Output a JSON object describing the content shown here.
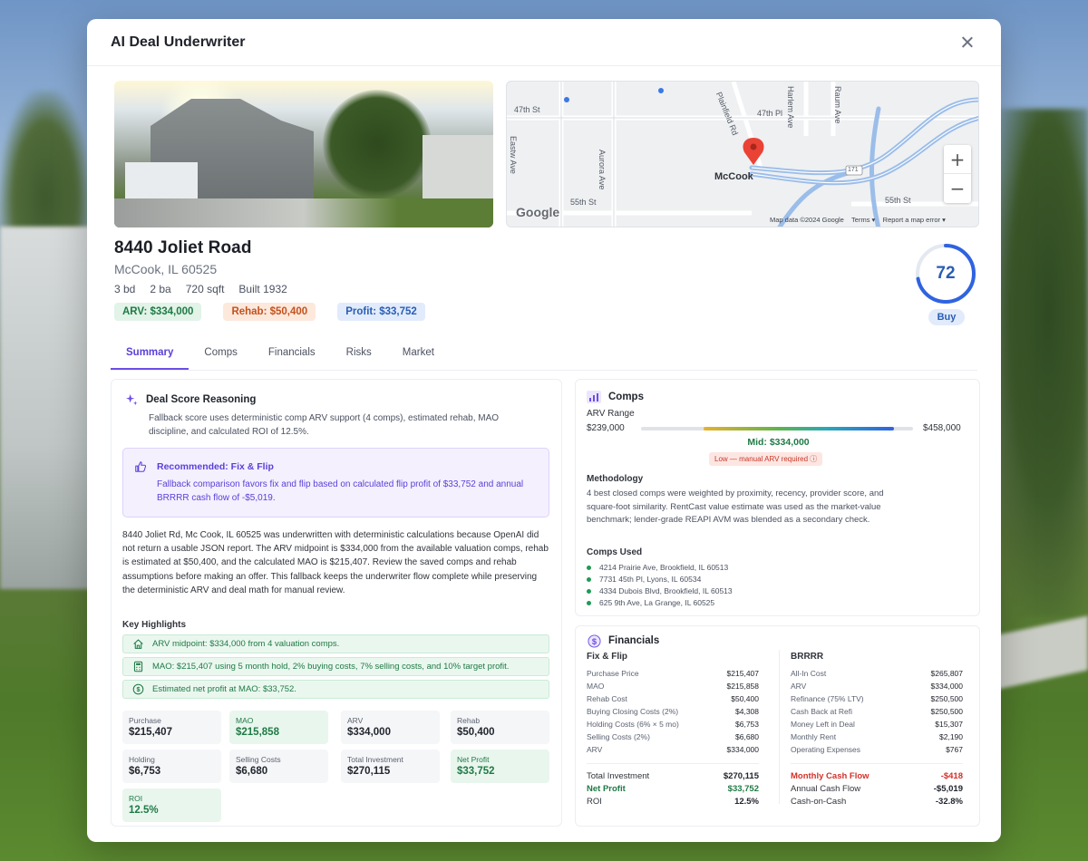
{
  "modal": {
    "title": "AI Deal Underwriter"
  },
  "map": {
    "city": "McCook",
    "streets": [
      "47th St",
      "47th Pl",
      "55th St",
      "55th St",
      "Eastw Ave",
      "Aurora Ave",
      "Harlem Ave",
      "Raum Ave",
      "Plainfield Rd"
    ],
    "route": "171",
    "google": "Google",
    "footer": {
      "data": "Map data ©2024 Google",
      "terms": "Terms",
      "report": "Report a map error"
    },
    "zoom_in": "+",
    "zoom_out": "−"
  },
  "property": {
    "address": "8440 Joliet Road",
    "city_line": "McCook, IL 60525",
    "beds": "3 bd",
    "baths": "2 ba",
    "sqft": "720 sqft",
    "built": "Built 1932",
    "pills": {
      "arv": "ARV: $334,000",
      "rehab": "Rehab: $50,400",
      "profit": "Profit: $33,752"
    }
  },
  "score": {
    "value": "72",
    "fraction": 0.72,
    "label": "Buy",
    "color": "#2f63e0"
  },
  "tabs": [
    "Summary",
    "Comps",
    "Financials",
    "Risks",
    "Market"
  ],
  "reasoning": {
    "title": "Deal Score Reasoning",
    "text": "Fallback score uses deterministic comp ARV support (4 comps), estimated rehab, MAO discipline, and calculated ROI of 12.5%.",
    "rec_title": "Recommended: Fix & Flip",
    "rec_text": "Fallback comparison favors fix and flip based on calculated flip profit of $33,752 and annual BRRRR cash flow of -$5,019.",
    "body": "8440 Joliet Rd, Mc Cook, IL 60525 was underwritten with deterministic calculations because OpenAI did not return a usable JSON report. The ARV midpoint is $334,000 from the available valuation comps, rehab is estimated at $50,400, and the calculated MAO is $215,407. Review the saved comps and rehab assumptions before making an offer. This fallback keeps the underwriter flow complete while preserving the deterministic ARV and deal math for manual review.",
    "highlights_label": "Key Highlights",
    "highlights": [
      "ARV midpoint: $334,000 from 4 valuation comps.",
      "MAO: $215,407 using 5 month hold, 2% buying costs, 7% selling costs, and 10% target profit.",
      "Estimated net profit at MAO: $33,752."
    ]
  },
  "metrics": [
    {
      "label": "Purchase",
      "value": "$215,407"
    },
    {
      "label": "MAO",
      "value": "$215,858"
    },
    {
      "label": "ARV",
      "value": "$334,000"
    },
    {
      "label": "Rehab",
      "value": "$50,400"
    },
    {
      "label": "Holding",
      "value": "$6,753"
    },
    {
      "label": "Selling Costs",
      "value": "$6,680"
    },
    {
      "label": "Total Investment",
      "value": "$270,115"
    },
    {
      "label": "Net Profit",
      "value": "$33,752"
    },
    {
      "label": "ROI",
      "value": "12.5%"
    }
  ],
  "comps": {
    "title": "Comps",
    "arv_range_label": "ARV Range",
    "low": "$239,000",
    "high": "$458,000",
    "fill_start": 0.23,
    "fill_end": 0.93,
    "mid": "Mid: $334,000",
    "warning": "Low — manual ARV required ⓘ",
    "methodology_label": "Methodology",
    "methodology": "4 best closed comps were weighted by proximity, recency, provider score, and square-foot similarity. RentCast value estimate was used as the market-value benchmark; lender-grade REAPI AVM was blended as a secondary check.",
    "used_label": "Comps Used",
    "used": [
      "4214 Prairie Ave, Brookfield, IL 60513",
      "7731 45th Pl, Lyons, IL 60534",
      "4334 Dubois Blvd, Brookfield, IL 60513",
      "625 9th Ave, La Grange, IL 60525"
    ]
  },
  "financials": {
    "title": "Financials",
    "flip": {
      "title": "Fix & Flip",
      "rows": [
        {
          "label": "Purchase Price",
          "value": "$215,407"
        },
        {
          "label": "MAO",
          "value": "$215,858"
        },
        {
          "label": "Rehab Cost",
          "value": "$50,400"
        },
        {
          "label": "Buying Closing Costs (2%)",
          "value": "$4,308"
        },
        {
          "label": "Holding Costs (6% × 5 mo)",
          "value": "$6,753"
        },
        {
          "label": "Selling Costs (2%)",
          "value": "$6,680"
        },
        {
          "label": "ARV",
          "value": "$334,000"
        }
      ],
      "total_label": "Total Investment",
      "total_value": "$270,115",
      "profit_label": "Net Profit",
      "profit_value": "$33,752",
      "roi_label": "ROI",
      "roi_value": "12.5%"
    },
    "brrrr": {
      "title": "BRRRR",
      "rows": [
        {
          "label": "All-In Cost",
          "value": "$265,807"
        },
        {
          "label": "ARV",
          "value": "$334,000"
        },
        {
          "label": "Refinance (75% LTV)",
          "value": "$250,500"
        },
        {
          "label": "Cash Back at Refi",
          "value": "$250,500"
        },
        {
          "label": "Money Left in Deal",
          "value": "$15,307"
        },
        {
          "label": "Monthly Rent",
          "value": "$2,190"
        },
        {
          "label": "Operating Expenses",
          "value": "$767"
        }
      ],
      "cash_label": "Monthly Cash Flow",
      "cash_value": "-$418",
      "annual_label": "Annual Cash Flow",
      "annual_value": "-$5,019",
      "coc_label": "Cash-on-Cash",
      "coc_value": "-32.8%"
    }
  }
}
